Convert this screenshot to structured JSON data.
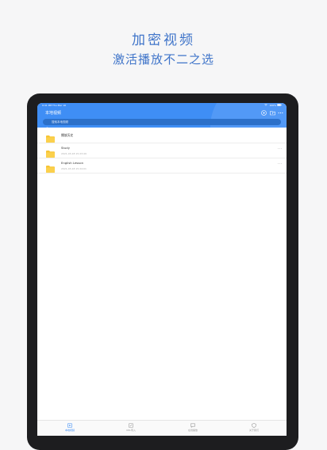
{
  "promo": {
    "title": "加密视频",
    "subtitle": "激活播放不二之选"
  },
  "status_bar": {
    "time": "9:41 PM  Thu Mar 16",
    "wifi": "wifi",
    "battery": "100%"
  },
  "header": {
    "title": "本地视频",
    "icons": [
      "add-icon",
      "folder-upload-icon",
      "more-icon"
    ]
  },
  "search": {
    "placeholder": "搜索本地视频"
  },
  "files": [
    {
      "name": "播放历史",
      "date": ""
    },
    {
      "name": "Study",
      "date": "2021-03-18 15:23:49"
    },
    {
      "name": "English Lesson",
      "date": "2021-03-18 15:24:01"
    }
  ],
  "tabs": [
    {
      "label": "本地视频",
      "icon": "video-icon",
      "active": true
    },
    {
      "label": "URL导入",
      "icon": "link-icon",
      "active": false
    },
    {
      "label": "在线播放",
      "icon": "chat-icon",
      "active": false
    },
    {
      "label": "关于我们",
      "icon": "shield-icon",
      "active": false
    }
  ],
  "colors": {
    "accent": "#3f8ef5",
    "promo_text": "#3f74c9",
    "folder": "#f7c535",
    "tab_inactive": "#999999"
  }
}
